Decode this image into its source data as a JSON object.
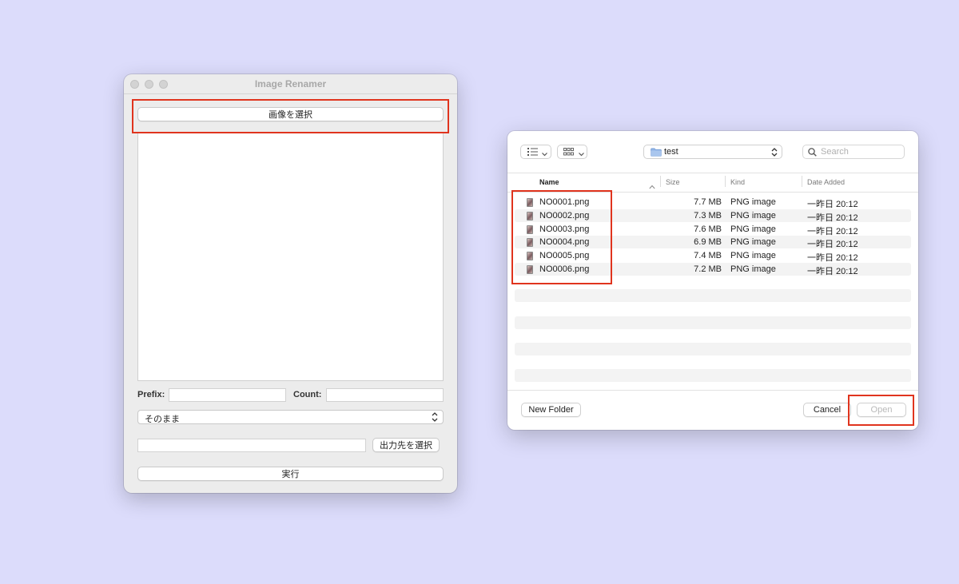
{
  "renamer": {
    "title": "Image Renamer",
    "select_images_label": "画像を選択",
    "prefix_label": "Prefix:",
    "count_label": "Count:",
    "prefix_value": "",
    "count_value": "",
    "mode_selected": "そのまま",
    "output_path_value": "",
    "choose_output_label": "出力先を選択",
    "run_label": "実行"
  },
  "dialog": {
    "location": "test",
    "search_placeholder": "Search",
    "columns": {
      "name": "Name",
      "size": "Size",
      "kind": "Kind",
      "date_added": "Date Added"
    },
    "files": [
      {
        "name": "NO0001.png",
        "size": "7.7 MB",
        "kind": "PNG image",
        "date": "一昨日 20:12"
      },
      {
        "name": "NO0002.png",
        "size": "7.3 MB",
        "kind": "PNG image",
        "date": "一昨日 20:12"
      },
      {
        "name": "NO0003.png",
        "size": "7.6 MB",
        "kind": "PNG image",
        "date": "一昨日 20:12"
      },
      {
        "name": "NO0004.png",
        "size": "6.9 MB",
        "kind": "PNG image",
        "date": "一昨日 20:12"
      },
      {
        "name": "NO0005.png",
        "size": "7.4 MB",
        "kind": "PNG image",
        "date": "一昨日 20:12"
      },
      {
        "name": "NO0006.png",
        "size": "7.2 MB",
        "kind": "PNG image",
        "date": "一昨日 20:12"
      }
    ],
    "new_folder_label": "New Folder",
    "cancel_label": "Cancel",
    "open_label": "Open"
  },
  "colors": {
    "background": "#dcdcfb",
    "highlight": "#e0341e"
  },
  "icons": [
    "list-view-icon",
    "grid-view-icon",
    "folder-icon",
    "search-icon",
    "sort-arrow-icon",
    "chevron-updown-icon"
  ]
}
